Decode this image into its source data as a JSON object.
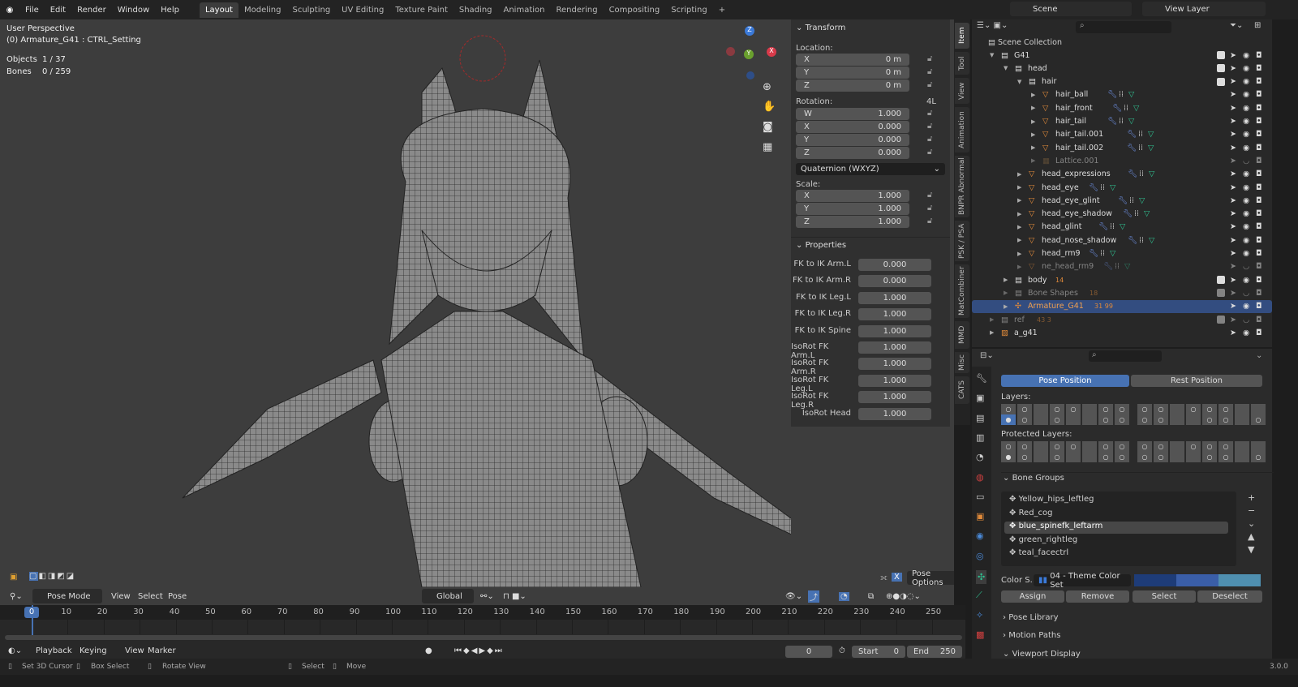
{
  "topbar": {
    "menus": [
      "File",
      "Edit",
      "Render",
      "Window",
      "Help"
    ],
    "workspaces": [
      "Layout",
      "Modeling",
      "Sculpting",
      "UV Editing",
      "Texture Paint",
      "Shading",
      "Animation",
      "Rendering",
      "Compositing",
      "Scripting",
      "+"
    ],
    "scene": "Scene",
    "view_layer": "View Layer"
  },
  "viewport": {
    "perspective": "User Perspective",
    "active": "(0) Armature_G41 : CTRL_Setting",
    "objects_label": "Objects",
    "objects_value": "1 / 37",
    "bones_label": "Bones",
    "bones_value": "0 / 259",
    "gizmo": {
      "z": "Z",
      "y": "Y",
      "x": "X"
    },
    "header": {
      "mode": "Pose Mode",
      "menus": [
        "View",
        "Select",
        "Pose"
      ],
      "orientation": "Global",
      "pose_options": "Pose Options",
      "x_mirror": "X"
    }
  },
  "npanel": {
    "transform_title": "Transform",
    "location_label": "Location:",
    "location": [
      [
        "X",
        "0 m"
      ],
      [
        "Y",
        "0 m"
      ],
      [
        "Z",
        "0 m"
      ]
    ],
    "rotation_label": "Rotation:",
    "rotation_flag": "4L",
    "rotation": [
      [
        "W",
        "1.000"
      ],
      [
        "X",
        "0.000"
      ],
      [
        "Y",
        "0.000"
      ],
      [
        "Z",
        "0.000"
      ]
    ],
    "rotation_mode": "Quaternion (WXYZ)",
    "scale_label": "Scale:",
    "scale": [
      [
        "X",
        "1.000"
      ],
      [
        "Y",
        "1.000"
      ],
      [
        "Z",
        "1.000"
      ]
    ],
    "properties_title": "Properties",
    "properties": [
      [
        "FK to IK Arm.L",
        "0.000"
      ],
      [
        "FK to IK Arm.R",
        "0.000"
      ],
      [
        "FK to IK Leg.L",
        "1.000"
      ],
      [
        "FK to IK Leg.R",
        "1.000"
      ],
      [
        "FK to IK Spine",
        "1.000"
      ],
      [
        "IsoRot FK Arm.L",
        "1.000"
      ],
      [
        "IsoRot FK Arm.R",
        "1.000"
      ],
      [
        "IsoRot FK Leg.L",
        "1.000"
      ],
      [
        "IsoRot FK Leg.R",
        "1.000"
      ],
      [
        "IsoRot Head",
        "1.000"
      ]
    ]
  },
  "side_tabs": [
    "Item",
    "Tool",
    "View",
    "Animation",
    "BNPR Abnormal",
    "PSK / PSA",
    "MatCombiner",
    "MMD",
    "Misc",
    "CATS"
  ],
  "outliner": {
    "root": "Scene Collection",
    "rows": [
      {
        "name": "G41",
        "type": "collection",
        "depth": 0,
        "open": true,
        "check": true
      },
      {
        "name": "head",
        "type": "collection",
        "depth": 1,
        "open": true,
        "check": true
      },
      {
        "name": "hair",
        "type": "collection",
        "depth": 2,
        "open": true,
        "check": true
      },
      {
        "name": "hair_ball",
        "type": "mesh",
        "depth": 3
      },
      {
        "name": "hair_front",
        "type": "mesh",
        "depth": 3
      },
      {
        "name": "hair_tail",
        "type": "mesh",
        "depth": 3
      },
      {
        "name": "hair_tail.001",
        "type": "mesh",
        "depth": 3
      },
      {
        "name": "hair_tail.002",
        "type": "mesh",
        "depth": 3
      },
      {
        "name": "Lattice.001",
        "type": "lattice",
        "depth": 3,
        "hidden": true
      },
      {
        "name": "head_expressions",
        "type": "mesh",
        "depth": 2
      },
      {
        "name": "head_eye",
        "type": "mesh",
        "depth": 2
      },
      {
        "name": "head_eye_glint",
        "type": "mesh",
        "depth": 2
      },
      {
        "name": "head_eye_shadow",
        "type": "mesh",
        "depth": 2
      },
      {
        "name": "head_glint",
        "type": "mesh",
        "depth": 2
      },
      {
        "name": "head_nose_shadow",
        "type": "mesh",
        "depth": 2
      },
      {
        "name": "head_rm9",
        "type": "mesh",
        "depth": 2
      },
      {
        "name": "ne_head_rm9",
        "type": "mesh",
        "depth": 2,
        "hidden": true
      },
      {
        "name": "body",
        "type": "collection",
        "depth": 1,
        "check": true,
        "badge": "14"
      },
      {
        "name": "Bone Shapes",
        "type": "collection",
        "depth": 1,
        "check": true,
        "hidden": true,
        "badge": "18"
      },
      {
        "name": "Armature_G41",
        "type": "armature",
        "depth": 1,
        "selected": true,
        "badge": "31 99"
      },
      {
        "name": "ref",
        "type": "collection",
        "depth": 0,
        "check": true,
        "hidden": true,
        "badge": "43 3"
      },
      {
        "name": "a_g41",
        "type": "image",
        "depth": 0
      }
    ]
  },
  "properties": {
    "pose_position": "Pose Position",
    "rest_position": "Rest Position",
    "layers_label": "Layers:",
    "protected_label": "Protected Layers:",
    "bone_groups_title": "Bone Groups",
    "bone_groups": [
      "Yellow_hips_leftleg",
      "Red_cog",
      "blue_spinefk_leftarm",
      "green_rightleg",
      "teal_facectrl"
    ],
    "active_group": 2,
    "color_set_label": "Color S...",
    "color_set": "04 - Theme Color Set",
    "color_swatches": [
      "#1e3c78",
      "#3a5ea8",
      "#4f8fb0"
    ],
    "assign": "Assign",
    "remove": "Remove",
    "select": "Select",
    "deselect": "Deselect",
    "pose_library": "Pose Library",
    "motion_paths": "Motion Paths",
    "viewport_display": "Viewport Display"
  },
  "timeline": {
    "current_frame": "0",
    "ticks": [
      "0",
      "10",
      "20",
      "30",
      "40",
      "50",
      "60",
      "70",
      "80",
      "90",
      "100",
      "110",
      "120",
      "130",
      "140",
      "150",
      "160",
      "170",
      "180",
      "190",
      "200",
      "210",
      "220",
      "230",
      "240",
      "250"
    ],
    "menus": [
      "Playback",
      "Keying",
      "View",
      "Marker"
    ],
    "frame_field": "0",
    "start_label": "Start",
    "start": "0",
    "end_label": "End",
    "end": "250"
  },
  "status": {
    "items": [
      "Set 3D Cursor",
      "Box Select",
      "Rotate View",
      "Select",
      "Move"
    ],
    "version": "3.0.0"
  },
  "colors": {
    "accent": "#4772b3",
    "selected_row": "#334d80",
    "mesh": "#e08a3a",
    "modifier": "#6b8cdc",
    "vgroup": "#2fbf8f"
  }
}
